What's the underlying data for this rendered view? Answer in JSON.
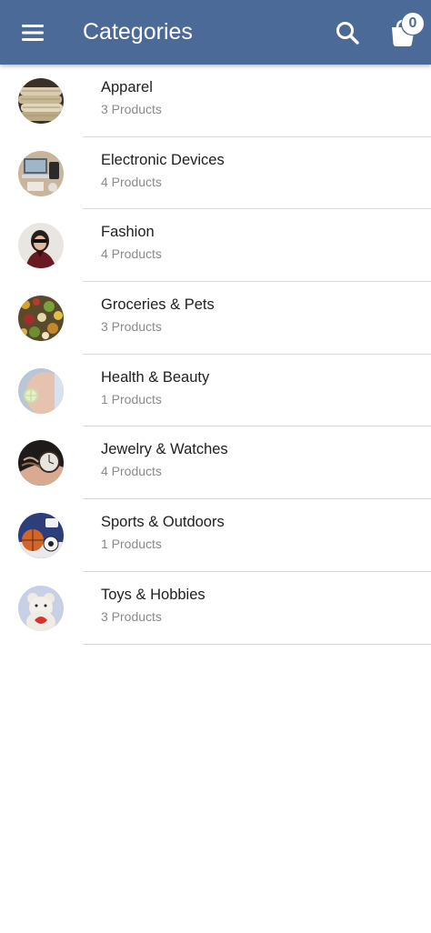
{
  "header": {
    "title": "Categories",
    "bar_color": "#4c6a98",
    "menu_icon": "hamburger-menu-icon",
    "search_icon": "search-icon",
    "cart_icon": "shopping-cart-icon",
    "cart_count": "0"
  },
  "categories": [
    {
      "name": "Apparel",
      "count": "3 Products",
      "icon": "apparel-thumbnail"
    },
    {
      "name": "Electronic Devices",
      "count": "4 Products",
      "icon": "electronic-devices-thumbnail"
    },
    {
      "name": "Fashion",
      "count": "4 Products",
      "icon": "fashion-thumbnail"
    },
    {
      "name": "Groceries & Pets",
      "count": "3 Products",
      "icon": "groceries-pets-thumbnail"
    },
    {
      "name": "Health & Beauty",
      "count": "1 Products",
      "icon": "health-beauty-thumbnail"
    },
    {
      "name": "Jewelry & Watches",
      "count": "4 Products",
      "icon": "jewelry-watches-thumbnail"
    },
    {
      "name": "Sports & Outdoors",
      "count": "1 Products",
      "icon": "sports-outdoors-thumbnail"
    },
    {
      "name": "Toys & Hobbies",
      "count": "3 Products",
      "icon": "toys-hobbies-thumbnail"
    }
  ]
}
